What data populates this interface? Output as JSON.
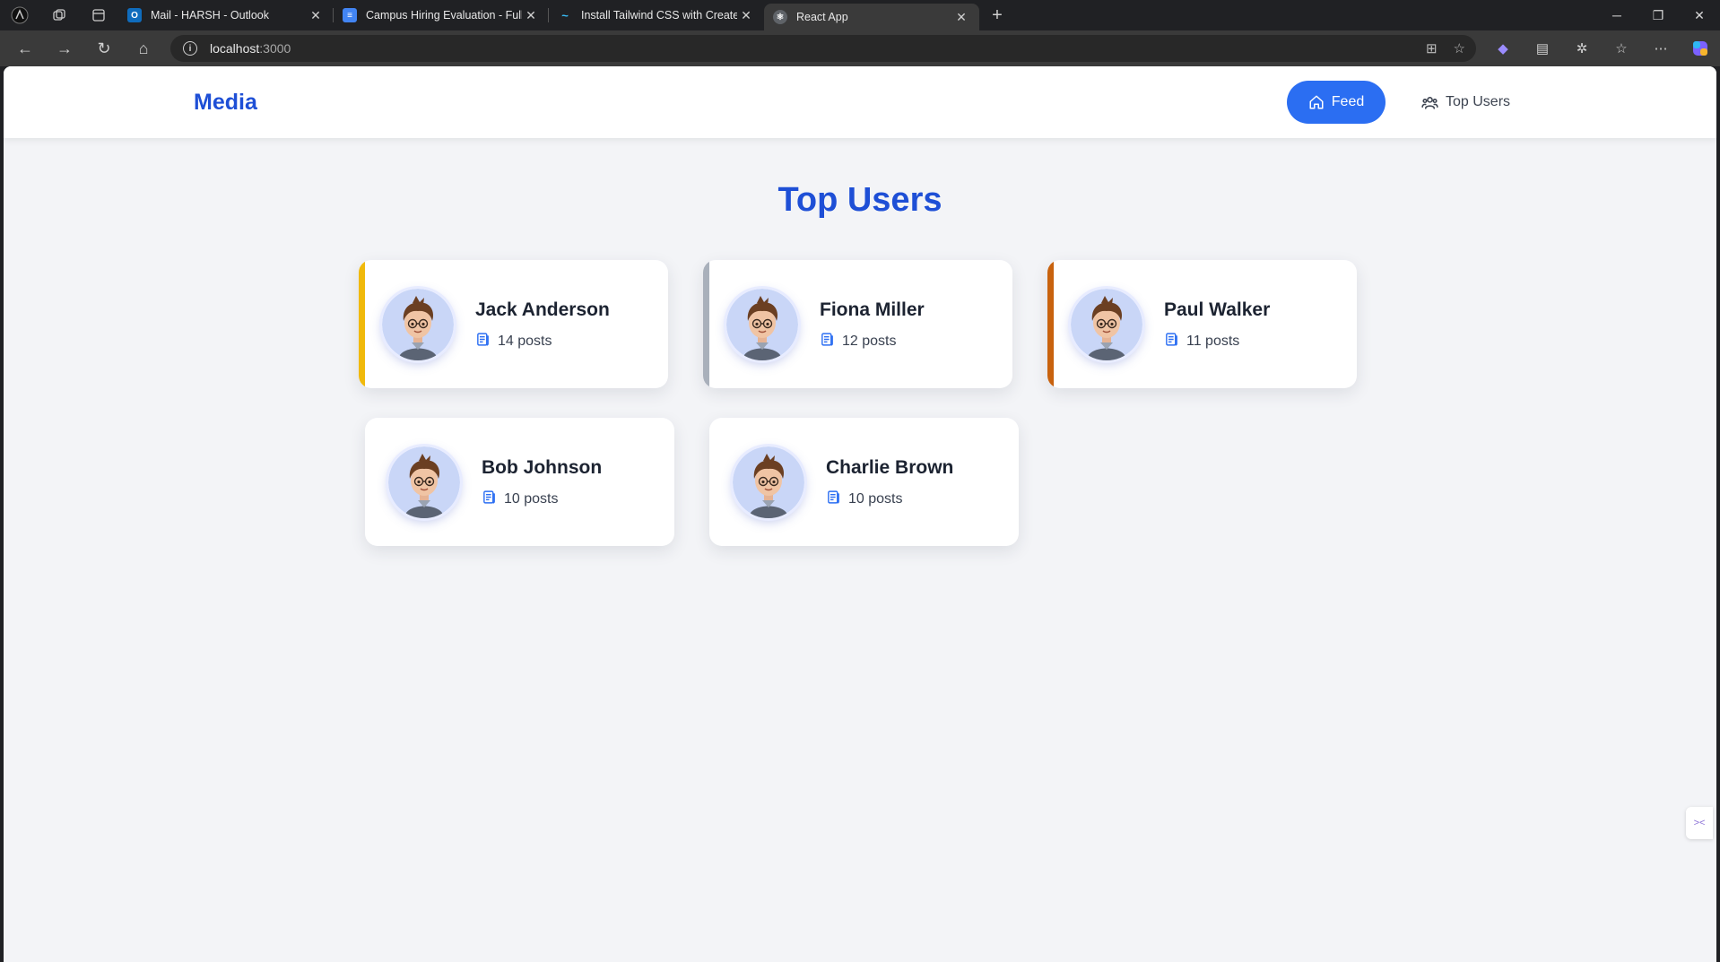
{
  "browser": {
    "tabs": [
      {
        "title": "Mail - HARSH - Outlook",
        "icon": "outlook-icon",
        "color": "#0f6cbd",
        "active": false
      },
      {
        "title": "Campus Hiring Evaluation - Full S",
        "icon": "docs-icon",
        "color": "#4285f4",
        "active": false
      },
      {
        "title": "Install Tailwind CSS with Create R",
        "icon": "tailwind-icon",
        "color": "#38bdf8",
        "active": false
      },
      {
        "title": "React App",
        "icon": "react-icon",
        "color": "#9aa0a6",
        "active": true
      }
    ],
    "address": {
      "host": "localhost",
      "port": ":3000"
    }
  },
  "app": {
    "brand": "Media",
    "nav": {
      "feed_label": "Feed",
      "top_users_label": "Top Users"
    },
    "page_title": "Top Users",
    "users": [
      {
        "name": "Jack Anderson",
        "posts": "14 posts",
        "accent": "#f0b90b"
      },
      {
        "name": "Fiona Miller",
        "posts": "12 posts",
        "accent": "#a9b0bb"
      },
      {
        "name": "Paul Walker",
        "posts": "11 posts",
        "accent": "#c8620e"
      },
      {
        "name": "Bob Johnson",
        "posts": "10 posts",
        "accent": ""
      },
      {
        "name": "Charlie Brown",
        "posts": "10 posts",
        "accent": ""
      }
    ],
    "colors": {
      "primary": "#2b6ef2",
      "heading": "#1e4fd6",
      "background": "#f3f4f7"
    }
  }
}
